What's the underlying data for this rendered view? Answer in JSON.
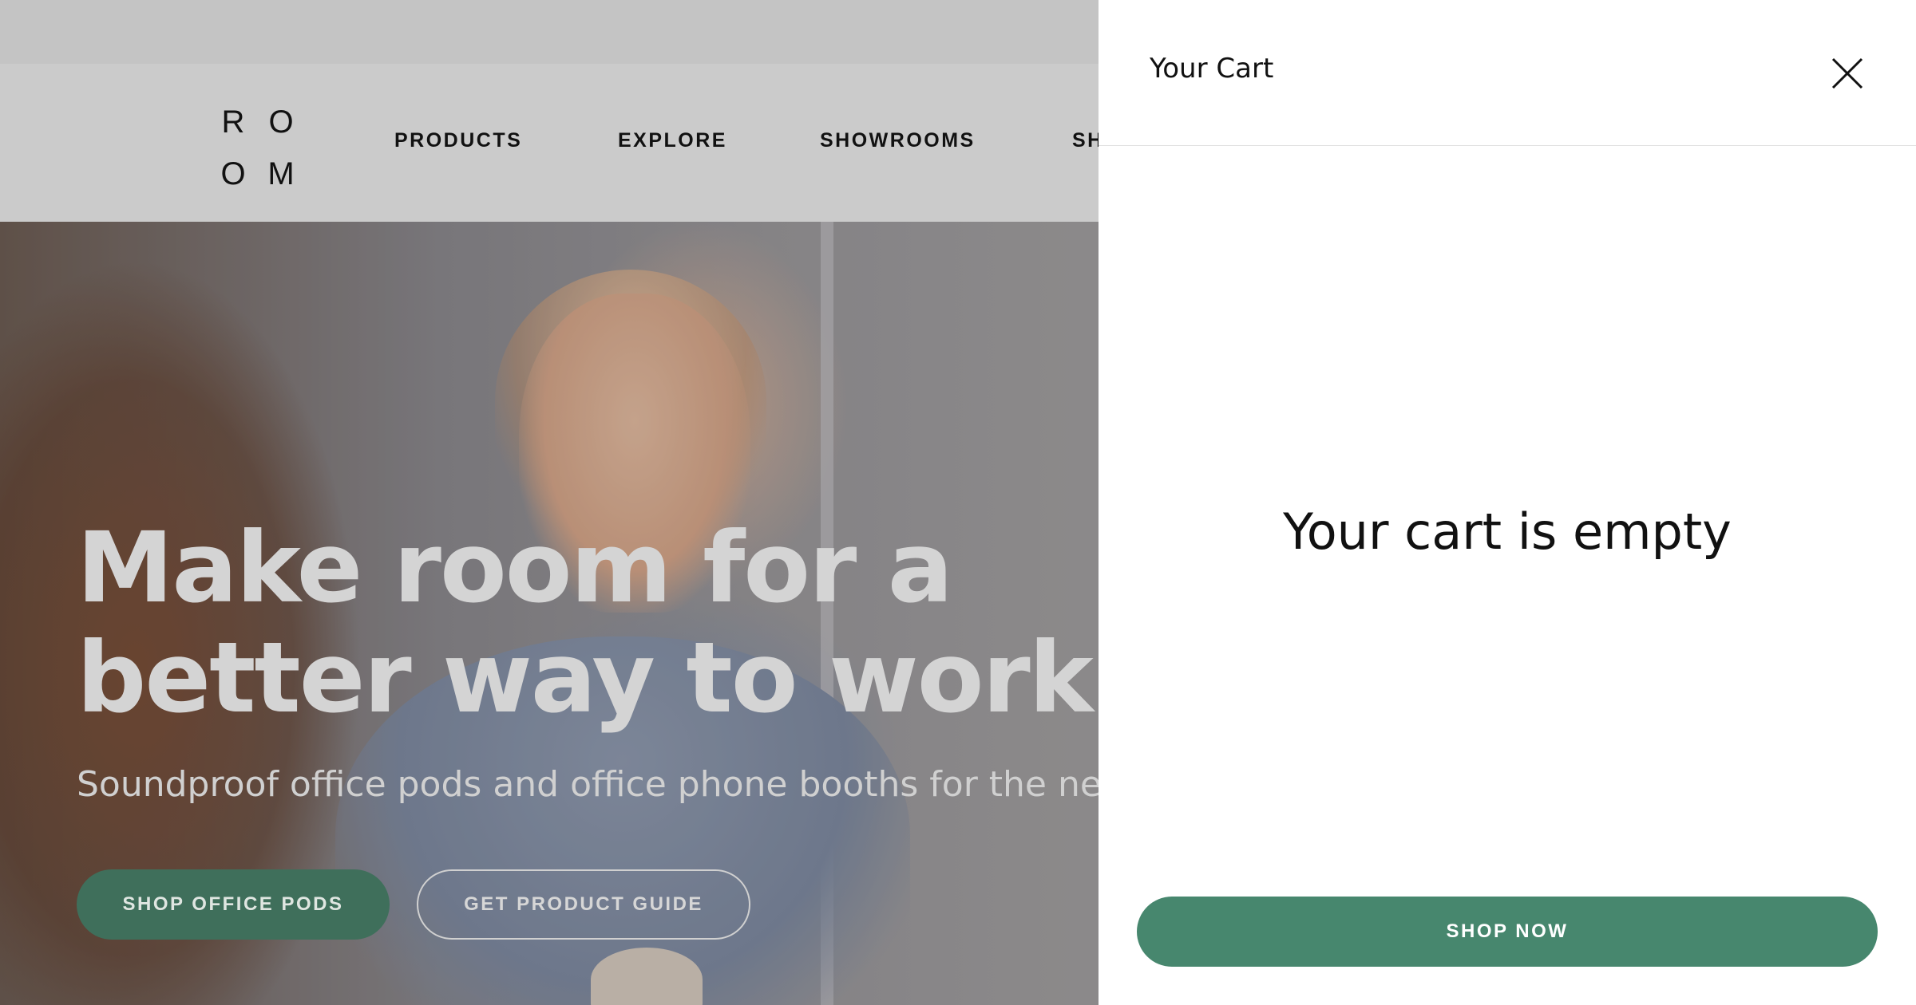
{
  "site": {
    "logo": {
      "letters": [
        "R",
        "O",
        "O",
        "M"
      ]
    },
    "nav": [
      "PRODUCTS",
      "EXPLORE",
      "SHOWROOMS",
      "SH"
    ],
    "hero": {
      "title_line1": "Make room for a",
      "title_line2": "better way to work",
      "subtitle": "Soundproof office pods and office phone booths for the nev",
      "primary_cta": "SHOP OFFICE PODS",
      "secondary_cta": "GET PRODUCT GUIDE"
    }
  },
  "cart": {
    "title": "Your Cart",
    "close_icon": "close-icon",
    "empty_message": "Your cart is empty",
    "cta": "SHOP NOW"
  },
  "colors": {
    "accent_green": "#47876e",
    "overlay_gray": "#cbcbcb",
    "drawer_bg": "#ffffff"
  }
}
